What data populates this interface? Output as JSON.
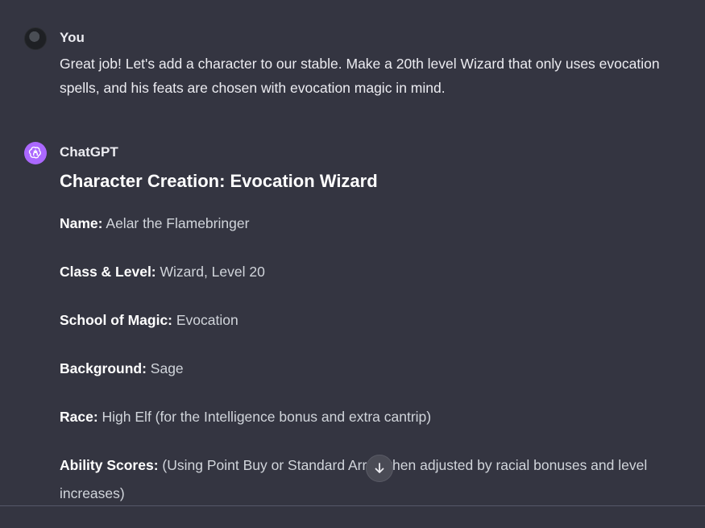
{
  "user_message": {
    "author": "You",
    "text": "Great job! Let's add a character to our stable. Make a 20th level Wizard that only uses evocation spells, and his feats are chosen with evocation magic in mind."
  },
  "assistant_message": {
    "author": "ChatGPT",
    "heading": "Character Creation: Evocation Wizard",
    "fields": [
      {
        "label": "Name:",
        "value": " Aelar the Flamebringer"
      },
      {
        "label": "Class & Level:",
        "value": " Wizard, Level 20"
      },
      {
        "label": "School of Magic:",
        "value": " Evocation"
      },
      {
        "label": "Background:",
        "value": " Sage"
      },
      {
        "label": "Race:",
        "value": " High Elf (for the Intelligence bonus and extra cantrip)"
      },
      {
        "label": "Ability Scores:",
        "value": " (Using Point Buy or Standard Array, then adjusted by racial bonuses and level increases)"
      }
    ]
  },
  "icons": {
    "user_avatar": "user-avatar-photo",
    "bot_avatar": "chatgpt-logo-icon",
    "scroll": "arrow-down-icon"
  },
  "colors": {
    "background": "#343541",
    "bot_avatar_bg": "#ab68ff"
  }
}
